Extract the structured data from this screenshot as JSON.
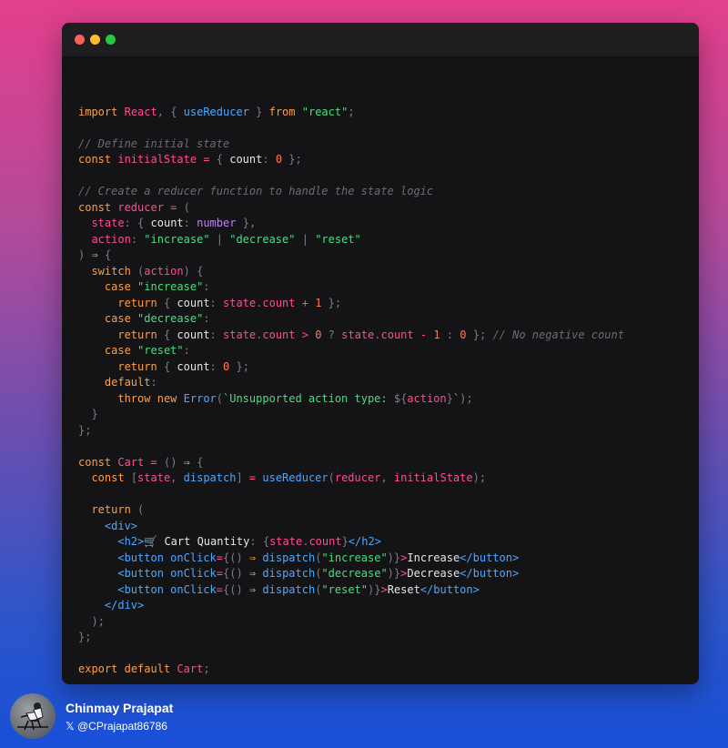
{
  "window": {
    "traffic_lights": [
      "close",
      "minimize",
      "zoom"
    ]
  },
  "code": {
    "language": "jsx",
    "lines": [
      "",
      "import React, { useReducer } from \"react\";",
      "",
      "// Define initial state",
      "const initialState = { count: 0 };",
      "",
      "// Create a reducer function to handle the state logic",
      "const reducer = (",
      "  state: { count: number },",
      "  action: \"increase\" | \"decrease\" | \"reset\"",
      ") ⇒ {",
      "  switch (action) {",
      "    case \"increase\":",
      "      return { count: state.count + 1 };",
      "    case \"decrease\":",
      "      return { count: state.count > 0 ? state.count - 1 : 0 }; // No negative count",
      "    case \"reset\":",
      "      return { count: 0 };",
      "    default:",
      "      throw new Error(`Unsupported action type: ${action}`);",
      "  }",
      "};",
      "",
      "const Cart = () ⇒ {",
      "  const [state, dispatch] = useReducer(reducer, initialState);",
      "",
      "  return (",
      "    <div>",
      "      <h2>🛒 Cart Quantity: {state.count}</h2>",
      "      <button onClick={() ⇒ dispatch(\"increase\")}>Increase</button>",
      "      <button onClick={() ⇒ dispatch(\"decrease\")}>Decrease</button>",
      "      <button onClick={() ⇒ dispatch(\"reset\")}>Reset</button>",
      "    </div>",
      "  );",
      "};",
      "",
      "export default Cart;"
    ]
  },
  "author": {
    "name": "Chinmay Prajapat",
    "handle": "𝕏 @CPrajapat86786",
    "avatar_icon": "person-sitting-avatar"
  },
  "colors": {
    "keyword": "#ff9f43",
    "identifier": "#ff4d8d",
    "function": "#4ea8ff",
    "string": "#4ade80",
    "number": "#ff7a59",
    "comment": "#6b6b73",
    "type": "#c77dff"
  }
}
